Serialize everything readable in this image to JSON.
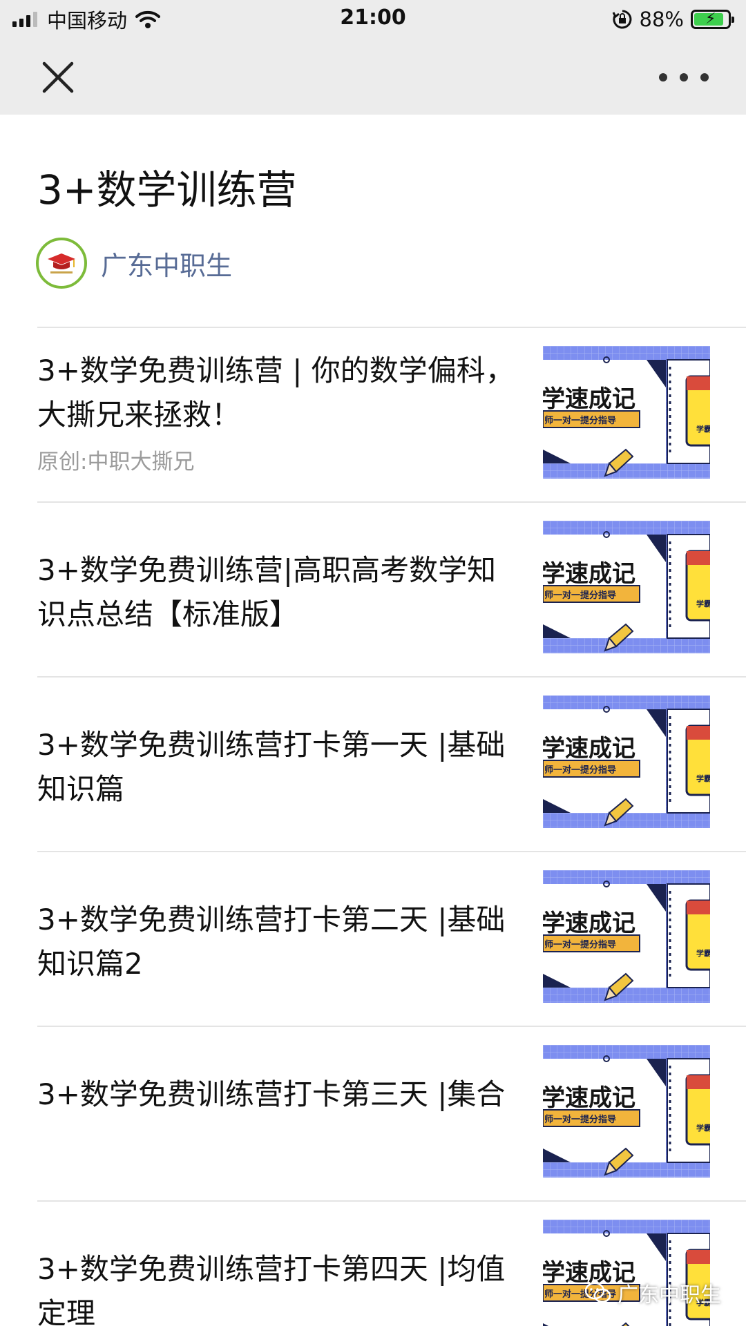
{
  "status_bar": {
    "carrier": "中国移动",
    "time": "21:00",
    "battery_percent": "88%",
    "battery_level": 0.88
  },
  "nav": {
    "close_icon": "close-icon",
    "more_icon": "more-icon"
  },
  "page": {
    "title": "3+数学训练营"
  },
  "account": {
    "name": "广东中职生"
  },
  "thumbnail": {
    "headline": "学速成记",
    "ribbon": "师一对一提分指导",
    "book_label": "学霸",
    "colors": {
      "grid_bg": "#7d8ef0",
      "ribbon": "#f2b43c",
      "book": "#ffe03a"
    }
  },
  "articles": [
    {
      "title": "3+数学免费训练营 | 你的数学偏科，大撕兄来拯救！",
      "source": "原创:中职大撕兄"
    },
    {
      "title": "3+数学免费训练营|高职高考数学知识点总结【标准版】"
    },
    {
      "title": "3+数学免费训练营打卡第一天 |基础知识篇"
    },
    {
      "title": "3+数学免费训练营打卡第二天 |基础知识篇2"
    },
    {
      "title": "3+数学免费训练营打卡第三天 |集合"
    },
    {
      "title": "3+数学免费训练营打卡第四天 |均值定理"
    }
  ],
  "watermark": {
    "text": "广东中职生"
  }
}
